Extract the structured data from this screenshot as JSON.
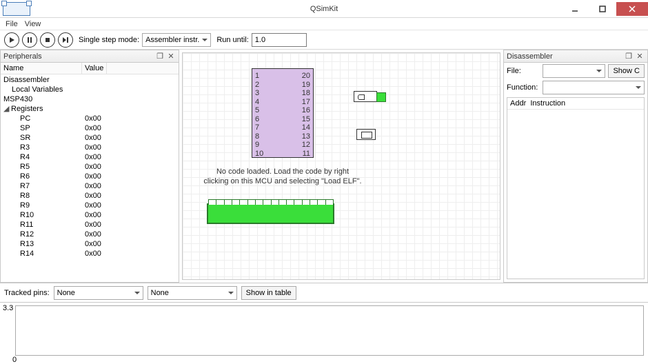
{
  "window": {
    "title": "QSimKit"
  },
  "menu": {
    "file": "File",
    "view": "View"
  },
  "toolbar": {
    "step_label": "Single step mode:",
    "step_value": "Assembler instr.",
    "run_until_label": "Run until:",
    "run_until_value": "1.0"
  },
  "peripherals": {
    "title": "Peripherals",
    "col_name": "Name",
    "col_value": "Value",
    "tree": {
      "disassembler": "Disassembler",
      "local_vars": "Local Variables",
      "msp430": "MSP430",
      "registers": "Registers"
    },
    "regs": [
      {
        "n": "PC",
        "v": "0x00"
      },
      {
        "n": "SP",
        "v": "0x00"
      },
      {
        "n": "SR",
        "v": "0x00"
      },
      {
        "n": "R3",
        "v": "0x00"
      },
      {
        "n": "R4",
        "v": "0x00"
      },
      {
        "n": "R5",
        "v": "0x00"
      },
      {
        "n": "R6",
        "v": "0x00"
      },
      {
        "n": "R7",
        "v": "0x00"
      },
      {
        "n": "R8",
        "v": "0x00"
      },
      {
        "n": "R9",
        "v": "0x00"
      },
      {
        "n": "R10",
        "v": "0x00"
      },
      {
        "n": "R11",
        "v": "0x00"
      },
      {
        "n": "R12",
        "v": "0x00"
      },
      {
        "n": "R13",
        "v": "0x00"
      },
      {
        "n": "R14",
        "v": "0x00"
      }
    ]
  },
  "canvas": {
    "pins_left": [
      "1",
      "2",
      "3",
      "4",
      "5",
      "6",
      "7",
      "8",
      "9",
      "10"
    ],
    "pins_right": [
      "20",
      "19",
      "18",
      "17",
      "16",
      "15",
      "14",
      "13",
      "12",
      "11"
    ],
    "message": "No code loaded. Load the code by right clicking on this MCU and selecting \"Load ELF\"."
  },
  "disasm": {
    "title": "Disassembler",
    "file_label": "File:",
    "func_label": "Function:",
    "show_c": "Show C",
    "col_addr": "Addr",
    "col_instr": "Instruction"
  },
  "tracked": {
    "label": "Tracked pins:",
    "val1": "None",
    "val2": "None",
    "show": "Show in table"
  },
  "plot": {
    "ymax": "3.3",
    "xmin": "0"
  }
}
